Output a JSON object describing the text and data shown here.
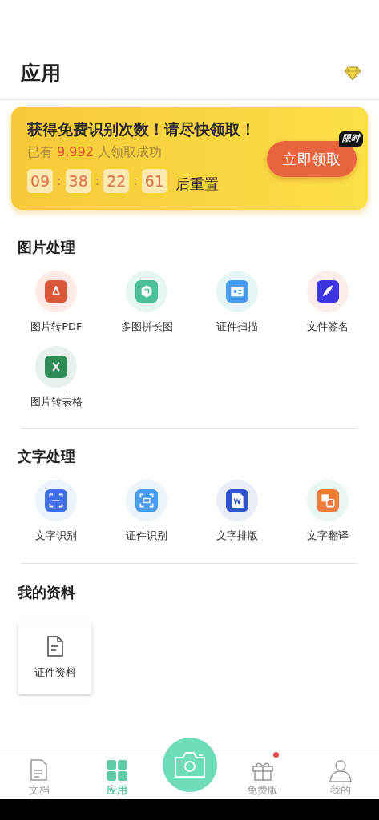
{
  "header": {
    "title": "应用"
  },
  "banner": {
    "headline": "获得免费识别次数！请尽快领取！",
    "count_prefix": "已有",
    "count": "9,992",
    "count_suffix": "人领取成功",
    "timer": [
      "09",
      "38",
      "22",
      "61"
    ],
    "separator": ":",
    "timer_suffix": "后重置",
    "button": "立即领取",
    "tag": "限时"
  },
  "sections": [
    {
      "title": "图片处理",
      "items": [
        {
          "label": "图片转PDF",
          "kind": "pdf"
        },
        {
          "label": "多图拼长图",
          "kind": "stitch"
        },
        {
          "label": "证件扫描",
          "kind": "idscan"
        },
        {
          "label": "文件签名",
          "kind": "sign"
        },
        {
          "label": "图片转表格",
          "kind": "excel"
        }
      ]
    },
    {
      "title": "文字处理",
      "items": [
        {
          "label": "文字识别",
          "kind": "ocr"
        },
        {
          "label": "证件识别",
          "kind": "idocr"
        },
        {
          "label": "文字排版",
          "kind": "word"
        },
        {
          "label": "文字翻译",
          "kind": "translate"
        }
      ]
    }
  ],
  "my_files": {
    "title": "我的资料",
    "cards": [
      {
        "label": "证件资料"
      }
    ]
  },
  "nav": [
    {
      "label": "文档",
      "kind": "doc",
      "selected": false,
      "dot": false
    },
    {
      "label": "应用",
      "kind": "apps",
      "selected": true,
      "dot": false
    },
    {
      "kind": "camera",
      "selected": false,
      "dot": false
    },
    {
      "label": "免费版",
      "kind": "gift",
      "selected": false,
      "dot": true
    },
    {
      "label": "我的",
      "kind": "me",
      "selected": false,
      "dot": false
    }
  ]
}
